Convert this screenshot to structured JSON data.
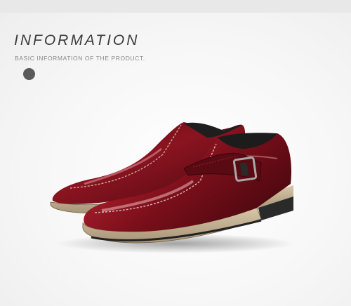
{
  "header": {
    "title": "INFORMATION",
    "subtitle": "BASIC INFORMATION OF THE PRODUCT."
  },
  "product_photo": {
    "subject": "burgundy-patent-leather-monk-strap-shoes",
    "colors": {
      "leather": "#7a0f1a",
      "highlight": "#e8a0a6",
      "sole": "#c9b79a",
      "heel": "#2a2a2a",
      "buckle": "#9a9a9a"
    }
  },
  "colors": {
    "heading": "#3c3c3c",
    "subheading": "#8a8a8a",
    "dot": "#5a5a5a",
    "top_bar": "#e8e8e8"
  }
}
